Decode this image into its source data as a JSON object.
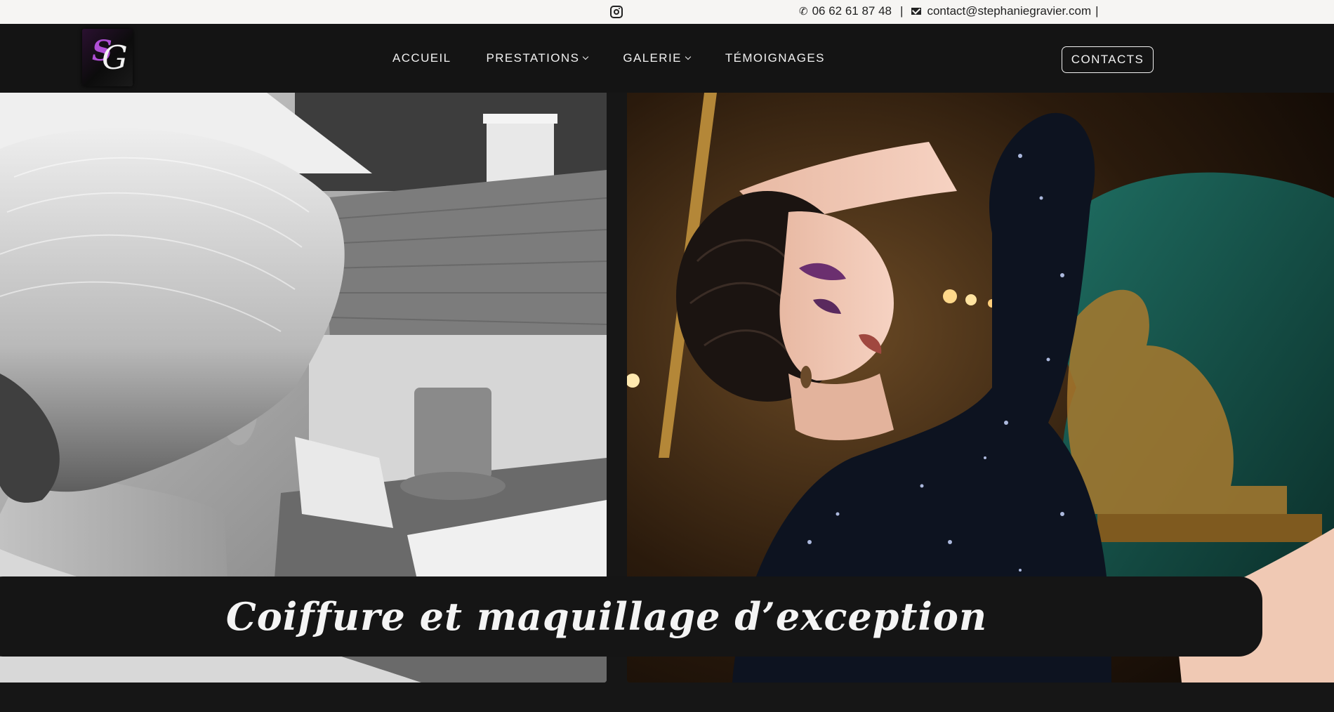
{
  "topbar": {
    "instagram_icon": "instagram-icon",
    "phone_icon": "phone-icon",
    "phone": "06 62 61 87 48",
    "separator": "|",
    "mail_icon": "mail-icon",
    "email": "contact@stephaniegravier.com",
    "trailing_separator": "|"
  },
  "logo": {
    "letter_s": "S",
    "letter_g": "G"
  },
  "nav": {
    "items": [
      {
        "label": "ACCUEIL",
        "has_dropdown": false
      },
      {
        "label": "PRESTATIONS",
        "has_dropdown": true
      },
      {
        "label": "GALERIE",
        "has_dropdown": true
      },
      {
        "label": "TÉMOIGNAGES",
        "has_dropdown": false
      }
    ],
    "contacts_button": "CONTACTS"
  },
  "hero": {
    "caption": "Coiffure et maquillage d’exception"
  },
  "colors": {
    "nav_background": "#141414",
    "topbar_background": "#f6f5f3",
    "text_light": "#f1f1f1",
    "accent_purple": "#b04fd6"
  }
}
